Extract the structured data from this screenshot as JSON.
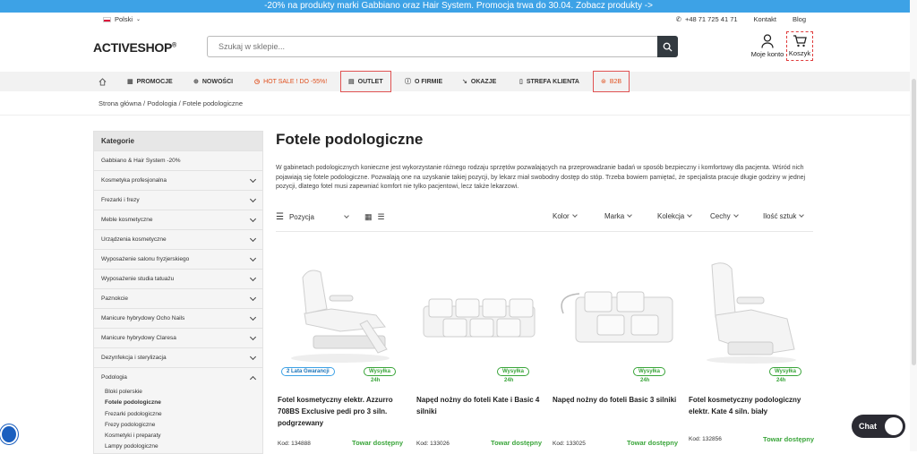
{
  "promo_bar": "-20% na produkty marki Gabbiano oraz Hair System. Promocja trwa do 30.04. Zobacz produkty ->",
  "topbar": {
    "language": "Polski",
    "phone": "+48 71 725 41 71",
    "contact": "Kontakt",
    "blog": "Blog"
  },
  "header": {
    "logo": "ACTIVESHOP",
    "logo_mark": "®",
    "search_placeholder": "Szukaj w sklepie...",
    "account": "Moje konto",
    "cart": "Koszyk"
  },
  "nav": [
    "PROMOCJE",
    "NOWOŚCI",
    "HOT SALE ! DO -55%!",
    "OUTLET",
    "O FIRMIE",
    "OKAZJE",
    "STREFA KLIENTA",
    "B2B"
  ],
  "breadcrumb": [
    "Strona główna",
    "Podologia",
    "Fotele podologiczne"
  ],
  "sidebar": {
    "heading": "Kategorie",
    "items": [
      "Gabbiano & Hair System -20%",
      "Kosmetyka profesjonalna",
      "Frezarki i frezy",
      "Meble kosmetyczne",
      "Urządzenia kosmetyczne",
      "Wyposażenie salonu fryzjerskiego",
      "Wyposażenie studia tatuażu",
      "Paznokcie",
      "Manicure hybrydowy Ocho Nails",
      "Manicure hybrydowy Claresa",
      "Dezynfekcja i sterylizacja",
      "Podologia"
    ],
    "subitems": [
      "Bloki polerskie",
      "Fotele podologiczne",
      "Frezarki podologiczne",
      "Frezy podologiczne",
      "Kosmetyki i preparaty",
      "Lampy podologiczne"
    ]
  },
  "page": {
    "title": "Fotele podologiczne",
    "description": "W gabinetach podologicznych konieczne jest wykorzystanie różnego rodzaju sprzętów pozwalających na przeprowadzanie badań w sposób bezpieczny i komfortowy dla pacjenta. Wśród nich pojawiają się fotele podologiczne. Pozwalają one na uzyskanie takiej pozycji, by lekarz miał swobodny dostęp do stóp. Trzeba bowiem pamiętać, że specjalista pracuje długie godziny w jednej pozycji, dlatego fotel musi zapewniać komfort nie tylko pacjentowi, lecz także lekarzowi."
  },
  "filters": {
    "sort": "Pozycja",
    "items": [
      "Kolor",
      "Marka",
      "Kolekcja",
      "Cechy",
      "Ilość sztuk"
    ]
  },
  "products": [
    {
      "name": "Fotel kosmetyczny elektr. Azzurro 708BS Exclusive pedi pro 3 siln. podgrzewany",
      "code": "Kod: 134888",
      "avail": "Towar dostępny",
      "shipping": "Wysyłka",
      "ship_time": "24h",
      "warranty": "2 Lata Gwarancji"
    },
    {
      "name": "Napęd nożny do foteli Kate i Basic 4 silniki",
      "code": "Kod: 133026",
      "avail": "Towar dostępny",
      "shipping": "Wysyłka",
      "ship_time": "24h"
    },
    {
      "name": "Napęd nożny do foteli Basic 3 silniki",
      "code": "Kod: 133025",
      "avail": "Towar dostępny",
      "shipping": "Wysyłka",
      "ship_time": "24h"
    },
    {
      "name": "Fotel kosmetyczny podologiczny elektr. Kate 4 siln. biały",
      "code": "Kod: 132856",
      "avail": "Towar dostępny",
      "shipping": "Wysyłka",
      "ship_time": "24h"
    }
  ],
  "chat": "Chat"
}
